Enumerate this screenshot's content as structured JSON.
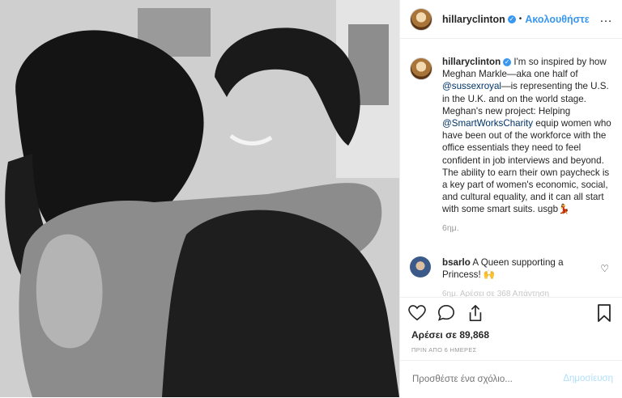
{
  "header": {
    "username": "hillaryclinton",
    "follow_label": "Ακολουθήστε",
    "more_icon": "…"
  },
  "caption": {
    "username": "hillaryclinton",
    "text_1": " I'm so inspired by how Meghan Markle—aka one half of ",
    "mention_1": "@sussexroyal",
    "text_2": "—is representing the U.S. in the U.K. and on the world stage. Meghan's new project: Helping ",
    "mention_2": "@SmartWorksCharity",
    "text_3": " equip women who have been out of the workforce with the office essentials they need to feel confident in job interviews and beyond. The ability to earn their own paycheck is a key part of women's economic, social, and cultural equality, and it can all start with some smart suits. usgb💃",
    "time": "6ημ."
  },
  "comment": {
    "username": "bsarlo",
    "text": " A Queen supporting a Princess! 🙌",
    "faded_text": "6ημ.   Αρέσει σε 368   Απάντηση"
  },
  "actions": {
    "likes": "Αρέσει σε 89,868",
    "date": "ΠΡΙΝ ΑΠΟ 6 ΗΜΕΡΕΣ"
  },
  "add_comment": {
    "placeholder": "Προσθέστε ένα σχόλιο...",
    "post_label": "Δημοσίευση"
  },
  "colors": {
    "accent": "#3897f0",
    "post_disabled": "#b2dffc"
  }
}
